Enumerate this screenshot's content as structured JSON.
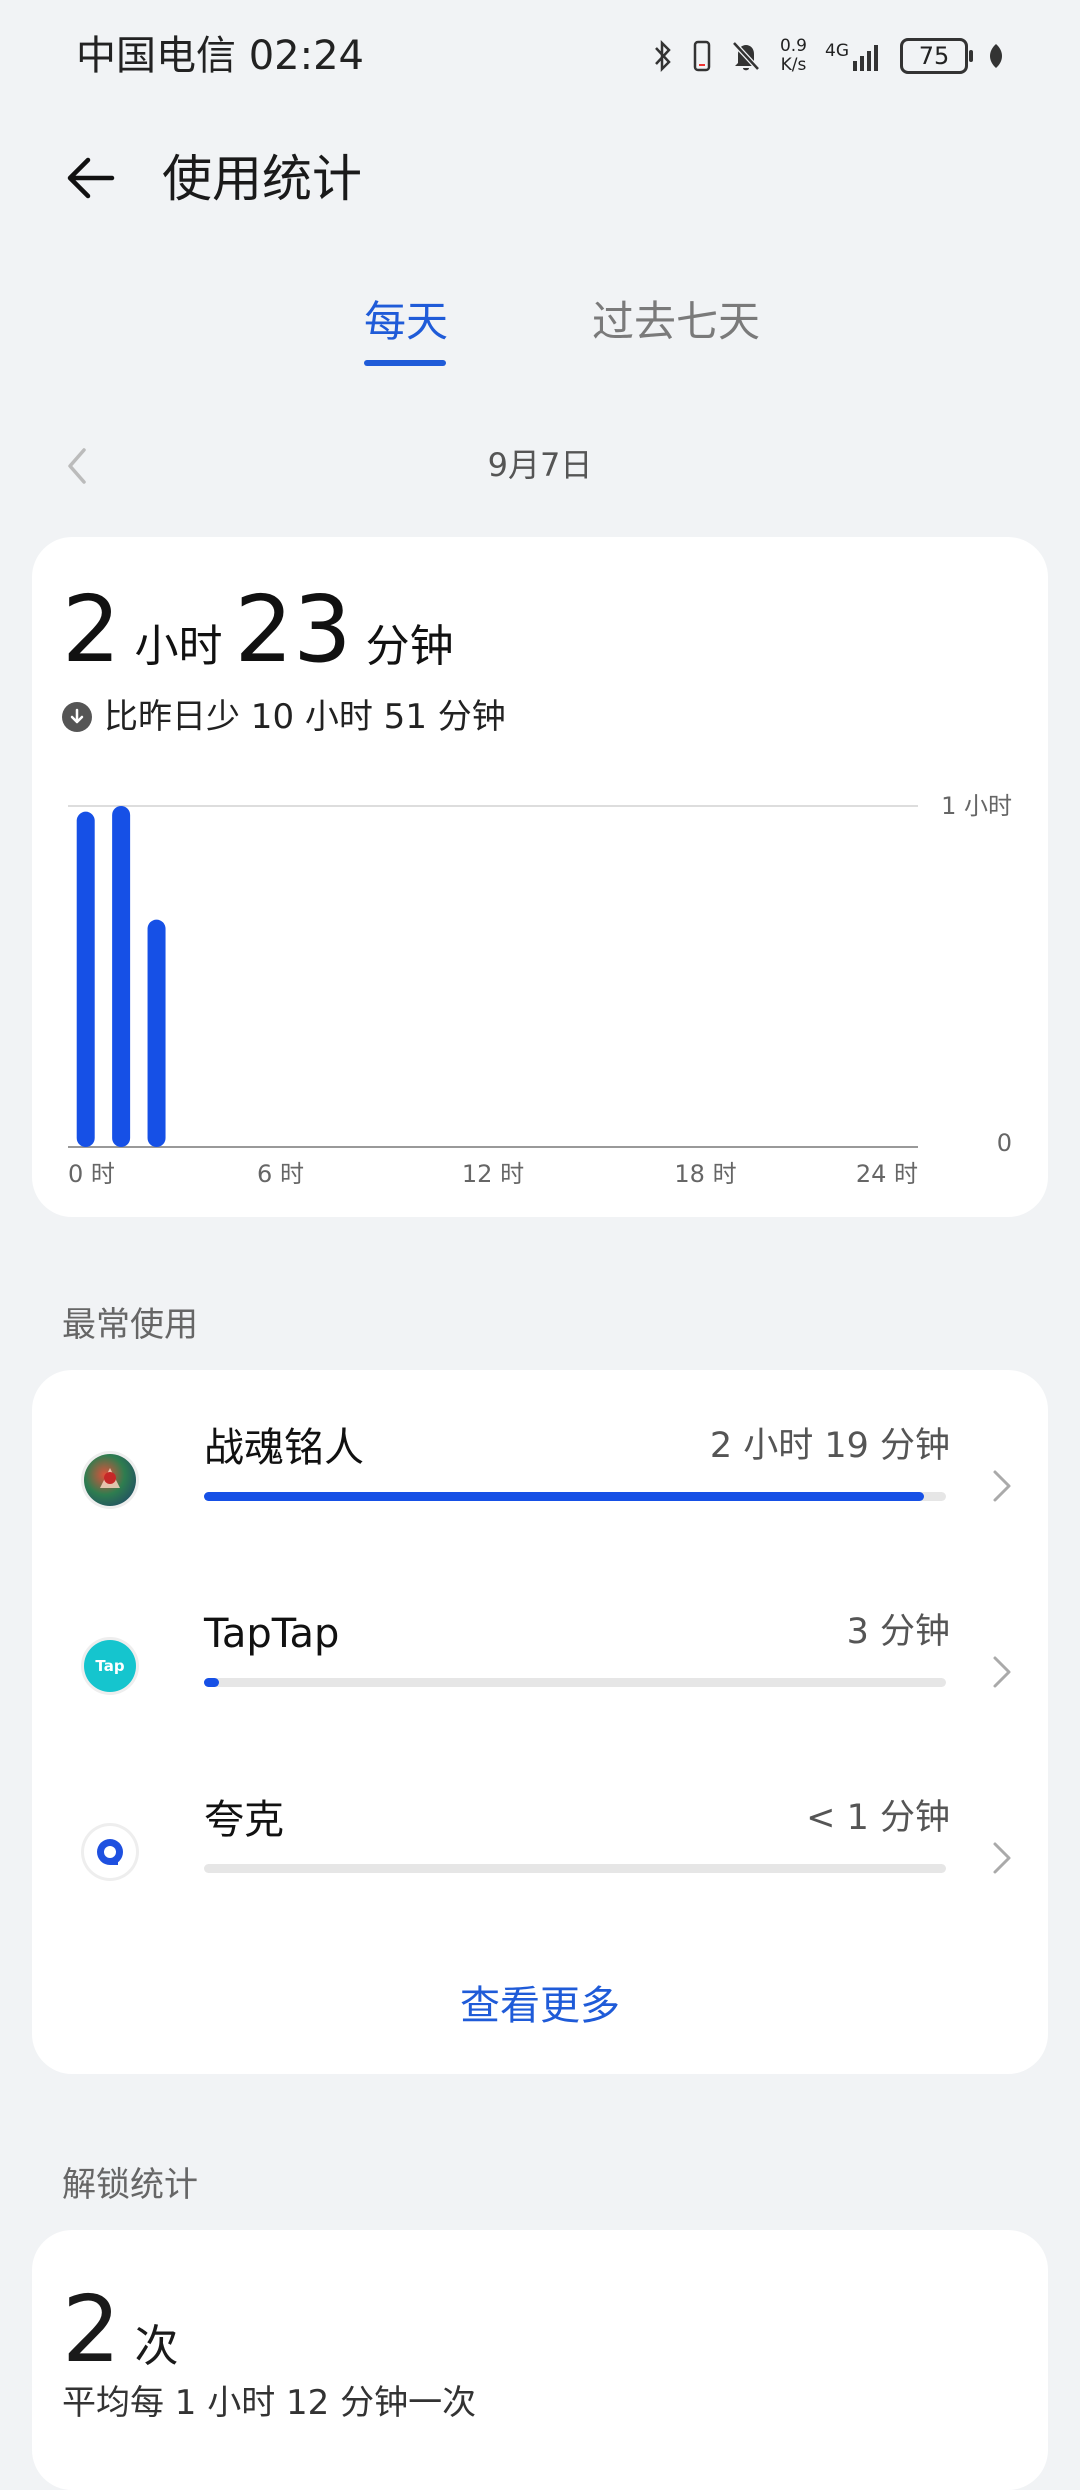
{
  "status_bar": {
    "carrier_time": "中国电信 02:24",
    "net_speed_value": "0.9",
    "net_speed_unit": "K/s",
    "signal_label": "4G",
    "battery": "75"
  },
  "header": {
    "title": "使用统计"
  },
  "tabs": {
    "daily": "每天",
    "week": "过去七天"
  },
  "date": {
    "label": "9月7日"
  },
  "summary": {
    "hours": "2",
    "hours_unit": "小时",
    "minutes": "23",
    "minutes_unit": "分钟",
    "compare_text": "比昨日少 10 小时 51 分钟"
  },
  "chart_data": {
    "type": "bar",
    "x_ticks": [
      "0 时",
      "6 时",
      "12 时",
      "18 时",
      "24 时"
    ],
    "y_ticks": [
      "1 小时",
      "0"
    ],
    "ylim": [
      0,
      60
    ],
    "y_unit": "minutes",
    "hours": [
      0,
      1,
      2
    ],
    "values": [
      59,
      60,
      40
    ],
    "bar_color": "#1650e6"
  },
  "most_used": {
    "label": "最常使用",
    "apps": [
      {
        "name": "战魂铭人",
        "time": "2 小时 19 分钟",
        "fraction": 0.97,
        "icon": "zhanhun-icon"
      },
      {
        "name": "TapTap",
        "time": "3 分钟",
        "fraction": 0.02,
        "icon": "taptap-icon",
        "icon_text": "Tap"
      },
      {
        "name": "夸克",
        "time": "< 1 分钟",
        "fraction": 0.0,
        "icon": "quark-icon"
      }
    ],
    "see_more": "查看更多"
  },
  "unlock": {
    "label": "解锁统计",
    "count": "2",
    "count_unit": "次",
    "average_text": "平均每 1 小时 12 分钟一次"
  }
}
